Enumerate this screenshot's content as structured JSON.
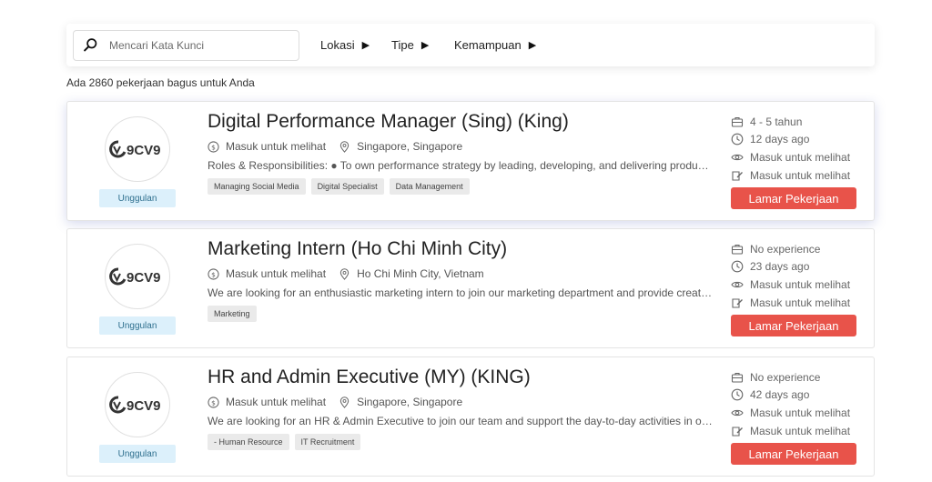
{
  "search": {
    "placeholder": "Mencari Kata Kunci"
  },
  "filters": [
    "Lokasi",
    "Tipe",
    "Kemampuan"
  ],
  "results_text": "Ada 2860 pekerjaan bagus untuk Anda",
  "jobs": [
    {
      "logo_text": "9CV9",
      "badge": "Unggulan",
      "title": "Digital Performance Manager (Sing) (King)",
      "salary": "Masuk untuk melihat",
      "location": "Singapore, Singapore",
      "description": "Roles & Responsibilities: ● To own performance strategy by leading, developing, and delivering product and campaign",
      "tags": [
        "Managing Social Media",
        "Digital Specialist",
        "Data Management"
      ],
      "experience": "4 - 5 tahun",
      "posted": "12 days ago",
      "views": "Masuk untuk melihat",
      "applicants": "Masuk untuk melihat",
      "apply_label": "Lamar Pekerjaan"
    },
    {
      "logo_text": "9CV9",
      "badge": "Unggulan",
      "title": "Marketing Intern (Ho Chi Minh City)",
      "salary": "Masuk untuk melihat",
      "location": "Ho Chi Minh City, Vietnam",
      "description": "We are looking for an enthusiastic marketing intern to join our marketing department and provide creative ideas",
      "tags": [
        "Marketing"
      ],
      "experience": "No experience",
      "posted": "23 days ago",
      "views": "Masuk untuk melihat",
      "applicants": "Masuk untuk melihat",
      "apply_label": "Lamar Pekerjaan"
    },
    {
      "logo_text": "9CV9",
      "badge": "Unggulan",
      "title": "HR and Admin Executive (MY) (KING)",
      "salary": "Masuk untuk melihat",
      "location": "Singapore, Singapore",
      "description": "We are looking for an HR & Admin Executive to join our team and support the day-to-day activities in our office",
      "tags": [
        "- Human Resource",
        "IT Recruitment"
      ],
      "experience": "No experience",
      "posted": "42 days ago",
      "views": "Masuk untuk melihat",
      "applicants": "Masuk untuk melihat",
      "apply_label": "Lamar Pekerjaan"
    }
  ],
  "colors": {
    "apply": "#e8534a",
    "badge_bg": "#dcf0fb",
    "badge_text": "#2e6f8e"
  },
  "icons": [
    "search-icon",
    "caret-right-icon",
    "dollar-circle-icon",
    "map-pin-icon",
    "briefcase-icon",
    "clock-icon",
    "eye-icon",
    "applicant-icon"
  ]
}
